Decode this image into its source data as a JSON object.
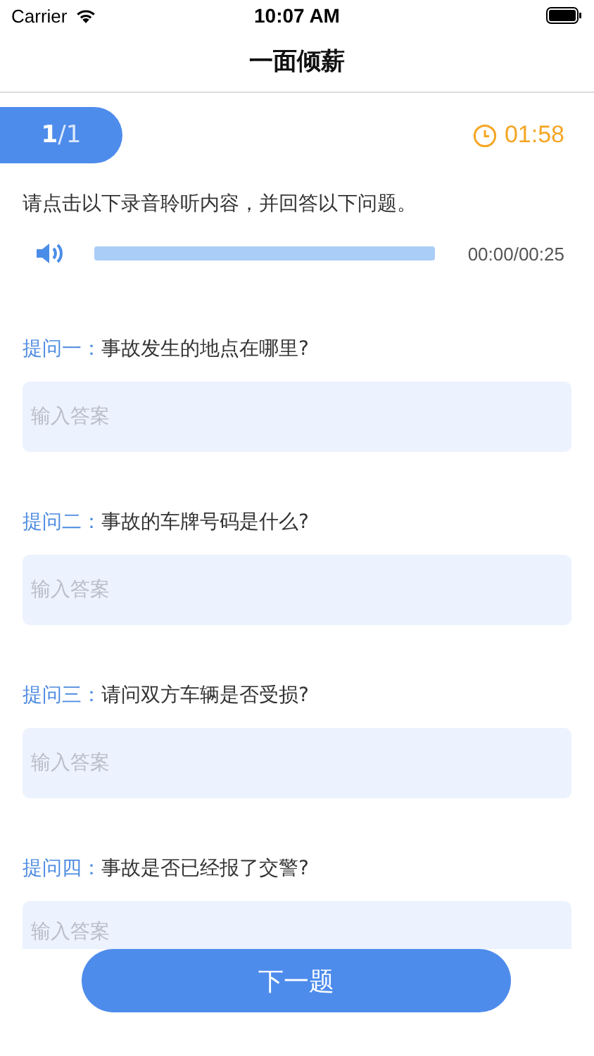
{
  "status_bar": {
    "carrier": "Carrier",
    "time": "10:07 AM"
  },
  "nav": {
    "title": "一面倾薪"
  },
  "progress": {
    "counter": "**1**/1",
    "timer": "01:58"
  },
  "instruction": "请点击以下录音聆听内容，并回答以下问题。",
  "audio": {
    "time": "00:00/00:25"
  },
  "questions": [
    {
      "label": "提问一：",
      "text": "事故发生的地点在哪里?",
      "placeholder": "输入答案"
    },
    {
      "label": "提问二：",
      "text": "事故的车牌号码是什么?",
      "placeholder": "输入答案"
    },
    {
      "label": "提问三：",
      "text": "请问双方车辆是否受损?",
      "placeholder": "输入答案"
    },
    {
      "label": "提问四：",
      "text": "事故是否已经报了交警?",
      "placeholder": "输入答案"
    }
  ],
  "next_button": "下一题"
}
